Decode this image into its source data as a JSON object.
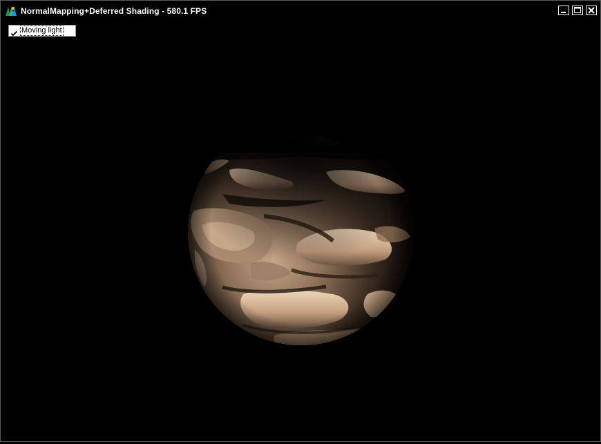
{
  "window": {
    "title": "NormalMapping+Deferred Shading - 580.1 FPS",
    "icon": "app-logo-icon",
    "controls": [
      "minimize-icon",
      "maximize-icon",
      "close-icon"
    ]
  },
  "options": {
    "moving_light": {
      "label": "Moving light",
      "checked": true
    }
  },
  "scene": {
    "object": "normal-mapped-sphere",
    "background": "#000000",
    "surface_color": "#d9b99a"
  }
}
